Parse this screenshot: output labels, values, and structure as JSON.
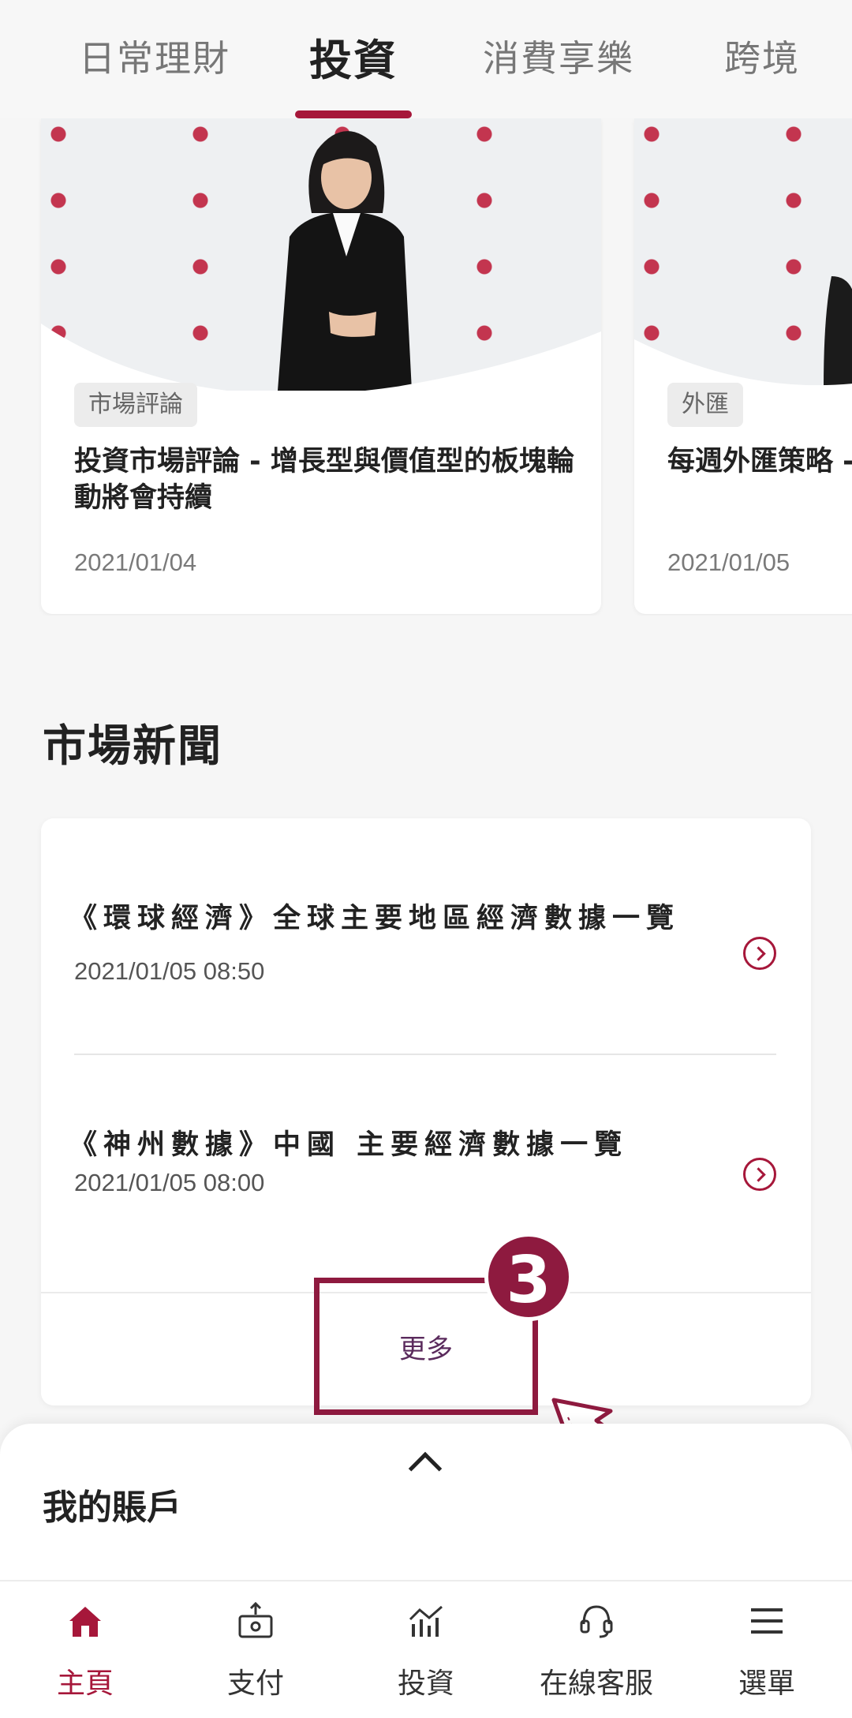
{
  "tabs": [
    {
      "label": "日常理財"
    },
    {
      "label": "投資"
    },
    {
      "label": "消費享樂"
    },
    {
      "label": "跨境"
    }
  ],
  "active_tab": "投資",
  "articles": [
    {
      "tag": "市場評論",
      "title": "投資市場評論 - 增長型與價值型的板塊輪動將會持續",
      "date": "2021/01/04"
    },
    {
      "tag": "外匯",
      "title": "每週外匯策略 - 減弱",
      "date": "2021/01/05"
    }
  ],
  "market_news": {
    "title": "市場新聞",
    "items": [
      {
        "title": "《環球經濟》全球主要地區經濟數據一覽",
        "date": "2021/01/05 08:50"
      },
      {
        "title": "《神州數據》中國 主要經濟數據一覽",
        "date": "2021/01/05 08:00"
      }
    ],
    "more_label": "更多"
  },
  "annotation": {
    "step": "3"
  },
  "account_drawer": {
    "title": "我的賬戶"
  },
  "bottom_nav": [
    {
      "label": "主頁",
      "icon": "home-icon"
    },
    {
      "label": "支付",
      "icon": "payment-icon"
    },
    {
      "label": "投資",
      "icon": "investment-chart-icon"
    },
    {
      "label": "在線客服",
      "icon": "headset-icon"
    },
    {
      "label": "選單",
      "icon": "menu-icon"
    }
  ],
  "colors": {
    "accent": "#a6173a",
    "annotation": "#8e1a3f"
  }
}
